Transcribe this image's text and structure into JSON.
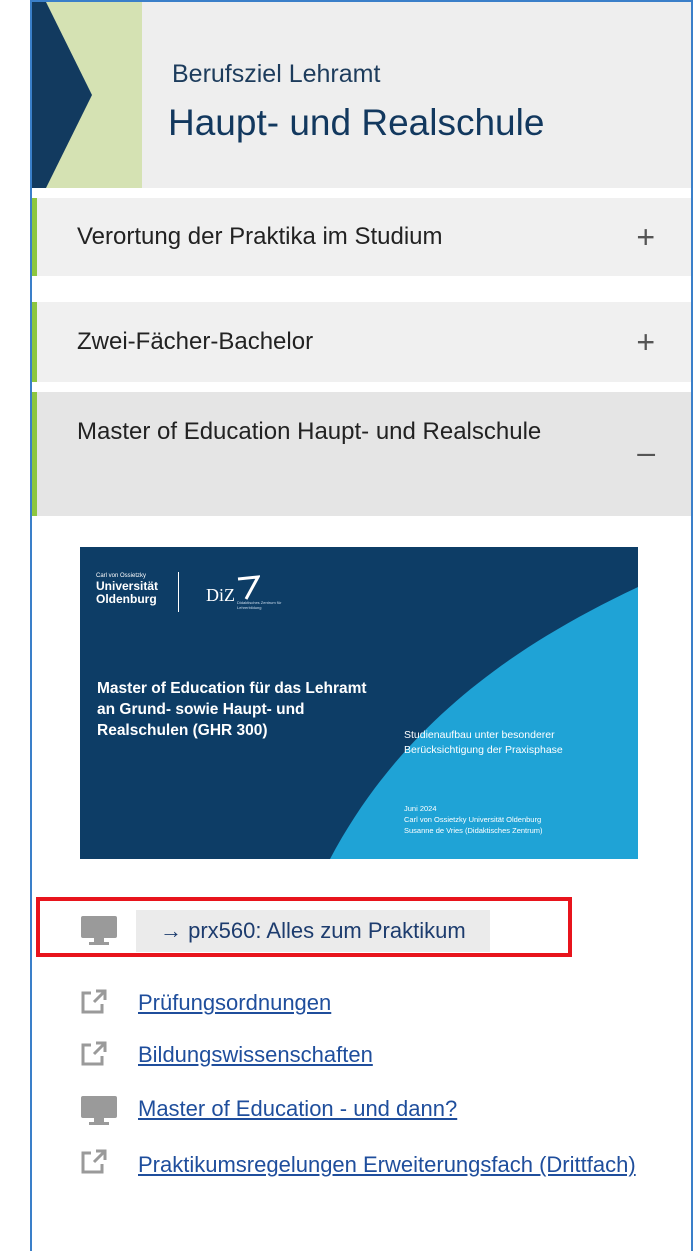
{
  "header": {
    "kicker": "Berufsziel Lehramt",
    "title": "Haupt- und Realschule",
    "colors": {
      "navy": "#123a5f",
      "green": "#d5e2b3",
      "accent": "#8dc63f"
    }
  },
  "accordion": [
    {
      "label": "Verortung der Praktika im Studium",
      "toggle": "+"
    },
    {
      "label": "Zwei-Fächer-Bachelor",
      "toggle": "+"
    },
    {
      "label": "Master of Education Haupt- und Realschule",
      "toggle": "–"
    }
  ],
  "slide": {
    "uni_small": "Carl von Ossietzky",
    "uni_line1": "Universität",
    "uni_line2": "Oldenburg",
    "diz": "DiZ",
    "diz_sub": "Didaktisches Zentrum für Lehrerbildung",
    "main": "Master of Education für das Lehramt an Grund- sowie Haupt- und Realschulen (GHR 300)",
    "sub": "Studienaufbau unter besonderer Berücksichtigung der Praxisphase",
    "date_line1": "Juni 2024",
    "date_line2": "Carl von Ossietzky Universität Oldenburg",
    "date_line3": "Susanne de Vries (Didaktisches Zentrum)"
  },
  "links": {
    "button_label": "→ prx560: Alles zum Praktikum",
    "items": [
      {
        "icon": "external-link-icon",
        "label": "Prüfungsordnungen"
      },
      {
        "icon": "external-link-icon",
        "label": "Bildungswissenschaften"
      },
      {
        "icon": "monitor-icon",
        "label": "Master of Education - und dann?"
      },
      {
        "icon": "external-link-icon",
        "label": "Praktikumsregelungen Erweiterungsfach (Drittfach)"
      }
    ],
    "highlight_color": "#e8141c"
  }
}
